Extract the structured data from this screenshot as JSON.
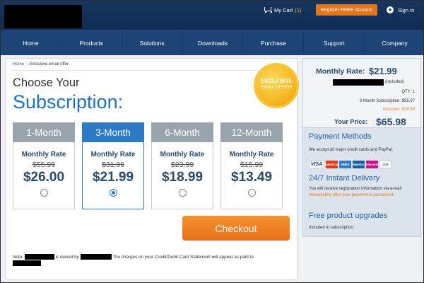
{
  "header": {
    "cart_label": "My Cart",
    "cart_count": "(1)",
    "register_label": "Register FREE Account",
    "signin_label": "Sign In"
  },
  "nav": {
    "items": [
      "Home",
      "Products",
      "Solutions",
      "Downloads",
      "Purchase",
      "Support",
      "Company"
    ]
  },
  "breadcrumb": {
    "home": "Home",
    "sep": "›",
    "current": "Exclusive email offer"
  },
  "heading": {
    "line1": "Choose Your",
    "line2": "Subscription:"
  },
  "badge": {
    "line1": "EXCLUSIVE",
    "line2": "EMAIL OFFER!"
  },
  "plans": [
    {
      "name": "1-Month",
      "rate_label": "Monthly Rate",
      "old_price": "$55.99",
      "price": "$26.00",
      "selected": false
    },
    {
      "name": "3-Month",
      "rate_label": "Monthly Rate",
      "old_price": "$31.99",
      "price": "$21.99",
      "selected": true
    },
    {
      "name": "6-Month",
      "rate_label": "Monthly Rate",
      "old_price": "$23.99",
      "price": "$18.99",
      "selected": false
    },
    {
      "name": "12-Month",
      "rate_label": "Monthly Rate",
      "old_price": "$15.99",
      "price": "$13.49",
      "selected": false
    }
  ],
  "checkout_label": "Checkout",
  "note": {
    "prefix": "Note:",
    "middle1": "is owned by",
    "middle2": "The charges on your Credit/Debit Card Statement will appear as paid to"
  },
  "summary": {
    "monthly_rate_label": "Monthly Rate:",
    "monthly_rate_value": "$21.99",
    "included": "(Included)",
    "qty": "QTY: 1",
    "subscription": "3-Month Subscription: $95.97",
    "discount": "Discount: $29.99",
    "your_price_label": "Your Price:",
    "your_price_value": "$65.98"
  },
  "payment": {
    "title": "Payment Methods",
    "text": "We accept all major credit cards and PayPal.",
    "cards": [
      "VISA",
      "MasterCard",
      "AMEX",
      "Maestro",
      "Discover",
      "JCB"
    ]
  },
  "delivery": {
    "title": "24/7 Instant Delivery",
    "text_before": "You will receive registration information via e-mail",
    "text_highlight": "immediately after your payment is processed."
  },
  "upgrades": {
    "title": "Free product upgrades",
    "text": "Included in subscription."
  }
}
